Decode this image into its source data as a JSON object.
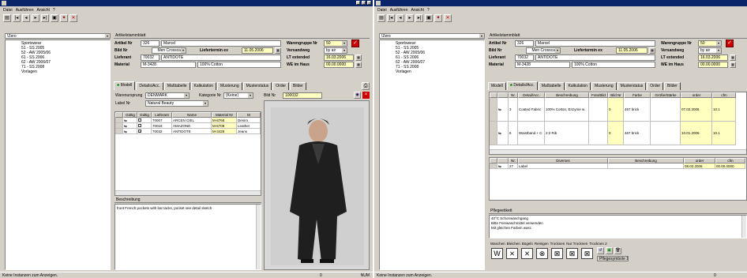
{
  "menu": [
    "Datei",
    "Ausführen",
    "Ansicht",
    "?"
  ],
  "left_panel": {
    "season_value": "!Zero",
    "tree": [
      "Sportswear",
      "51 - SS 2005",
      "52 - AW 2005/06",
      "61 - SS 2006",
      "62 - AW 2006/07",
      "71 - SS 2008",
      "Vorlagen"
    ]
  },
  "article": {
    "section_title": "Artikelstammblatt",
    "label_article_nr": "Artikel Nr",
    "article_nr": "326",
    "article_name": "Marcel",
    "label_bild_nr": "Bild Nr",
    "bild_nr_value": "Men Crosscar",
    "label_liefertermin": "Liefertermin ex",
    "liefertermin": "11.05.2006",
    "label_lieferant": "Lieferant",
    "lieferant_nr": "70032",
    "lieferant_name": "ANTIDOTE",
    "label_material": "Material",
    "material_nr": "M-3428",
    "material_desc": "100% Cotton",
    "label_warengruppe": "Warengruppe Nr",
    "warengruppe": "50",
    "label_versandweg": "Versandweg",
    "versandweg": "by air",
    "label_lt_extended": "LT extended",
    "lt_extended": "16.03.2006",
    "label_we_im_haus": "WE im Haus",
    "we_im_haus": "00.00.0000"
  },
  "tabs_left": [
    "Modell",
    "Details/Acc.",
    "Maßtabelle",
    "Kalkulation",
    "Musterung",
    "Musterstatus",
    "Order",
    "Bilder"
  ],
  "tabs_right": [
    "Modell",
    "Details/Acc.",
    "Maßtabelle",
    "Kalkulation",
    "Musterung",
    "Musterstatus",
    "Order",
    "Bilder"
  ],
  "modell": {
    "label_warenursprung": "Warenursprung",
    "warenursprung": "DENMARK",
    "label_kategorie": "Kategorie Nr",
    "kategorie": "(Keine)",
    "label_label_nr": "Label Nr",
    "label_nr": "Natural Beauty",
    "label_bild_nr": "Bild Nr",
    "bild_nr": "100032",
    "grid_headers": [
      "",
      "Gültig",
      "Lieferant",
      "Name",
      "Material Nr",
      "M"
    ],
    "grid_rows": [
      {
        "checked": false,
        "lieferant": "70007",
        "name": "ARCEN CIEL",
        "material": "M-8768",
        "m": "Denim"
      },
      {
        "checked": false,
        "lieferant": "70019",
        "name": "AMAZONE",
        "material": "M-6709",
        "m": "Leather"
      },
      {
        "checked": true,
        "lieferant": "70032",
        "name": "ANTIDOTE",
        "material": "M-3428",
        "m": "Jeans"
      }
    ],
    "beschreibung_title": "Beschreibung",
    "beschreibung_text": "front French pockets with bar tacks, pocket see detail sketch"
  },
  "details": {
    "headers": [
      "",
      "Nr.",
      "Detail/Acc.",
      "Beschreibung",
      "Foto/Bild",
      "Bild Nr",
      "Farbe",
      "Größe/Stärke",
      "order",
      "cfm"
    ],
    "rows": [
      {
        "nr": "3",
        "detail": "Coated Fabric",
        "beschreibung": "100% Cotton, Enzyme w",
        "bild_nr": "0",
        "farbe": "467 brick",
        "order": "07.02.2006",
        "cfm": "10.1"
      },
      {
        "nr": "6",
        "detail": "Waistband + C",
        "beschreibung": "2:2 Rib",
        "bild_nr": "0",
        "farbe": "467 brick",
        "order": "10.01.2006",
        "cfm": "10.1"
      }
    ],
    "div_headers": [
      "",
      "Nr.",
      "Diverses",
      "Beschreibung",
      "order",
      "cfm"
    ],
    "div_rows": [
      {
        "nr": "27",
        "diverses": "Label",
        "beschreibung": "",
        "order": "08.02.2006",
        "cfm": "00.00.0000"
      }
    ],
    "pflege_title": "Pflegeetikett",
    "pflege_text": [
      "40°C Schonwaschgang",
      "Bitte Feinwaschmittel verwenden",
      "Mit gleichen Farben wasc"
    ],
    "care_labels": [
      "Waschen",
      "Bleichen",
      "Bügeln",
      "Reinigen",
      "Trocknen",
      "Nur Trocknen",
      "Trocknen 2"
    ],
    "care_icons": [
      "W",
      "⨯",
      "⨯",
      "⊗",
      "⊠",
      "⊠",
      "⊠"
    ],
    "pflegesymbole": "Pflegesymbole 1"
  },
  "status": {
    "text": "Keine Instanzen zum Anzeigen.",
    "count": "0",
    "mode": "NUM"
  },
  "colors": {
    "title_bar": "#0a246a",
    "face": "#d4d0c8",
    "yellow_field": "#ffffc0",
    "red_flag": "#cc0000"
  }
}
